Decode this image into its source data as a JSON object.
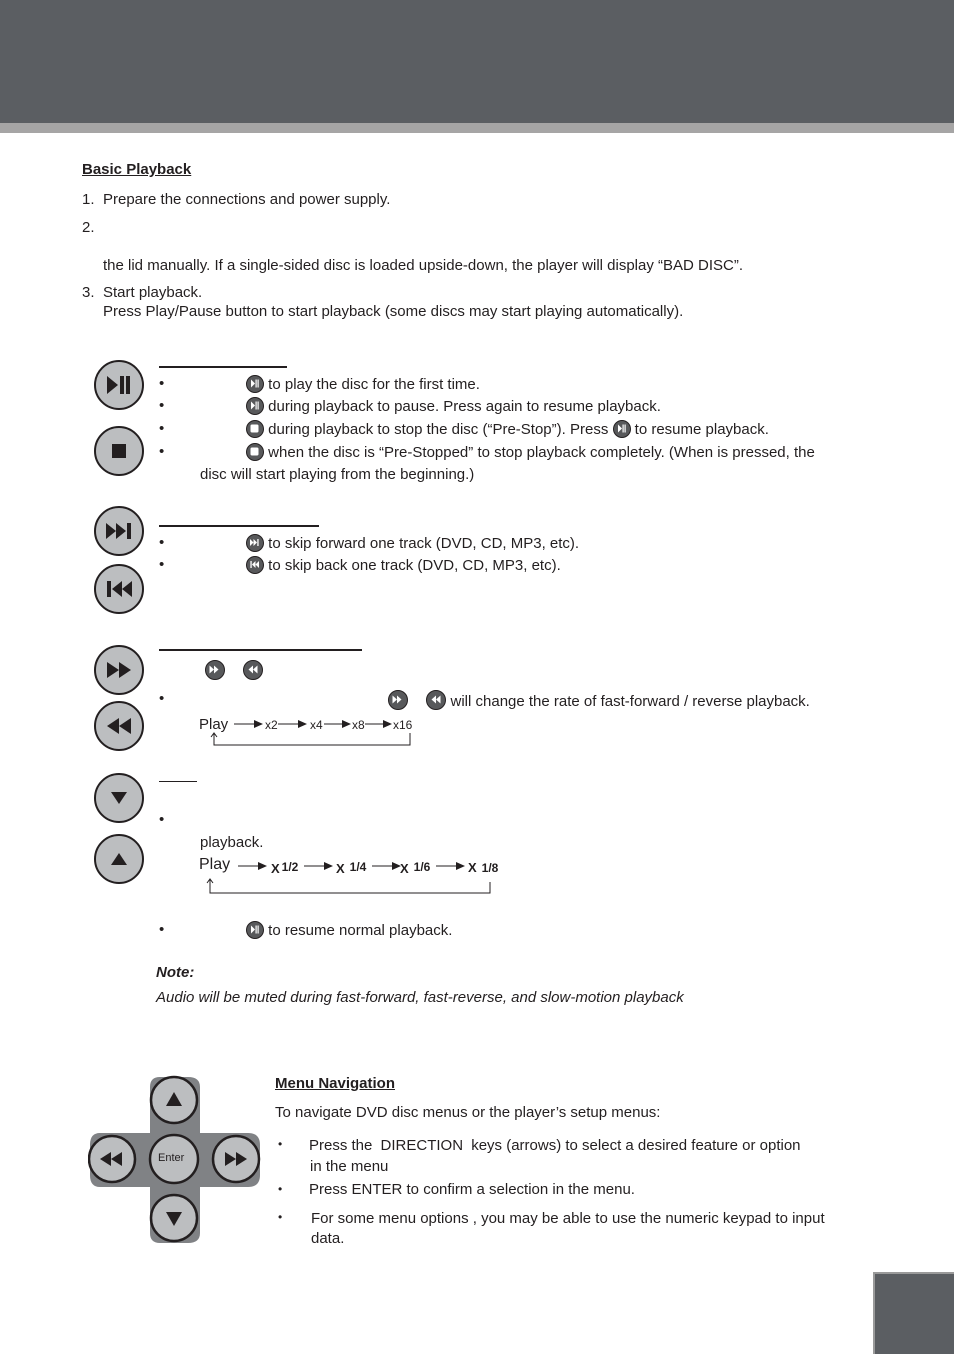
{
  "header": {
    "band_color": "#5b5e62",
    "stripe_color": "#a6a5a5"
  },
  "basic_playback": {
    "title": "Basic Playback",
    "steps": [
      {
        "num": "1.",
        "text": "Prepare the connections and power supply."
      },
      {
        "num": "2.",
        "text": "",
        "continuation": "the lid manually. If a single-sided disc is loaded upside-down, the player will display “BAD DISC”."
      },
      {
        "num": "3.",
        "text": "Start playback.",
        "continuation": "Press Play/Pause button to start playback (some discs may start playing automatically)."
      }
    ]
  },
  "play_stop": {
    "bullets": [
      "to play the disc for the first time.",
      "during playback to pause. Press again to resume playback.",
      " during playback to stop the disc (“Pre-Stop”). Press",
      "when the disc is “Pre-Stopped” to stop playback completely. (When is pressed, the"
    ],
    "bullet3_tail": "to resume playback.",
    "bullet4_continuation": "disc will start playing from the beginning.)"
  },
  "skip": {
    "bullets": [
      "to skip forward one track (DVD, CD, MP3, etc).",
      "to skip back one track (DVD, CD, MP3, etc)."
    ]
  },
  "fast": {
    "bullet": "will change the rate of fast-forward / reverse playback.",
    "sequence": [
      "Play",
      "x2",
      "x4",
      "x8",
      "x16"
    ]
  },
  "slow": {
    "continuation": "playback.",
    "sequence_start": "Play",
    "sequence": [
      {
        "x": "X",
        "frac": "1/2"
      },
      {
        "x": "X",
        "frac": "1/4"
      },
      {
        "x": "X",
        "frac": "1/6"
      },
      {
        "x": "X",
        "frac": "1/8"
      }
    ],
    "resume": "to resume normal playback."
  },
  "note": {
    "label": "Note:",
    "text": "Audio will be muted during fast-forward, fast-reverse, and slow-motion playback"
  },
  "menu_navigation": {
    "title": "Menu Navigation",
    "intro": "To navigate DVD disc menus or the player’s setup menus:",
    "bullets": [
      {
        "line1_a": "Press the ",
        "line1_key": "DIRECTION",
        "line1_b": " keys (arrows) to select a desired feature or option",
        "line2": "in the menu"
      },
      {
        "line1_a": "Press ENTER to confirm a selection in the menu.",
        "line1_key": "",
        "line1_b": "",
        "line2": ""
      },
      {
        "line1_a": "For some menu options , you may be able to use the numeric keypad to input",
        "line1_key": "",
        "line1_b": "",
        "line2": "data."
      }
    ],
    "dpad": {
      "center_label": "Enter"
    }
  },
  "icons": {
    "play_pause": "play-pause-icon",
    "stop": "stop-icon",
    "next": "skip-next-icon",
    "prev": "skip-previous-icon",
    "ff": "fast-forward-icon",
    "rew": "rewind-icon",
    "down": "down-arrow-icon",
    "up": "up-arrow-icon"
  }
}
